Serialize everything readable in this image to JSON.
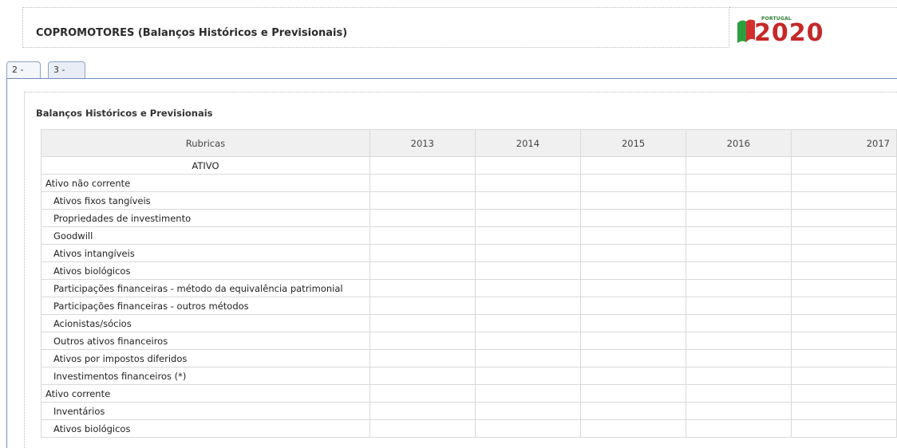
{
  "header": {
    "title": "COPROMOTORES (Balanços Históricos e Previsionais)"
  },
  "logo": {
    "country": "PORTUGAL",
    "year": "2020"
  },
  "tabs": [
    {
      "label": "2 -"
    },
    {
      "label": "3 -"
    }
  ],
  "section": {
    "title": "Balanços Históricos e Previsionais"
  },
  "table": {
    "headers": [
      "Rubricas",
      "2013",
      "2014",
      "2015",
      "2016",
      "2017"
    ],
    "rows": [
      {
        "label": "ATIVO",
        "style": "center"
      },
      {
        "label": "Ativo não corrente",
        "style": "group"
      },
      {
        "label": "Ativos fixos tangíveis",
        "style": "indent"
      },
      {
        "label": "Propriedades de investimento",
        "style": "indent"
      },
      {
        "label": "Goodwill",
        "style": "indent"
      },
      {
        "label": "Ativos intangíveis",
        "style": "indent"
      },
      {
        "label": "Ativos biológicos",
        "style": "indent"
      },
      {
        "label": "Participações financeiras - método da equivalência patrimonial",
        "style": "indent"
      },
      {
        "label": "Participações financeiras - outros métodos",
        "style": "indent"
      },
      {
        "label": "Acionistas/sócios",
        "style": "indent"
      },
      {
        "label": "Outros ativos financeiros",
        "style": "indent"
      },
      {
        "label": "Ativos por impostos diferidos",
        "style": "indent"
      },
      {
        "label": "Investimentos financeiros (*)",
        "style": "indent"
      },
      {
        "label": "Ativo corrente",
        "style": "group"
      },
      {
        "label": "Inventários",
        "style": "indent"
      },
      {
        "label": "Ativos biológicos",
        "style": "indent"
      }
    ]
  }
}
